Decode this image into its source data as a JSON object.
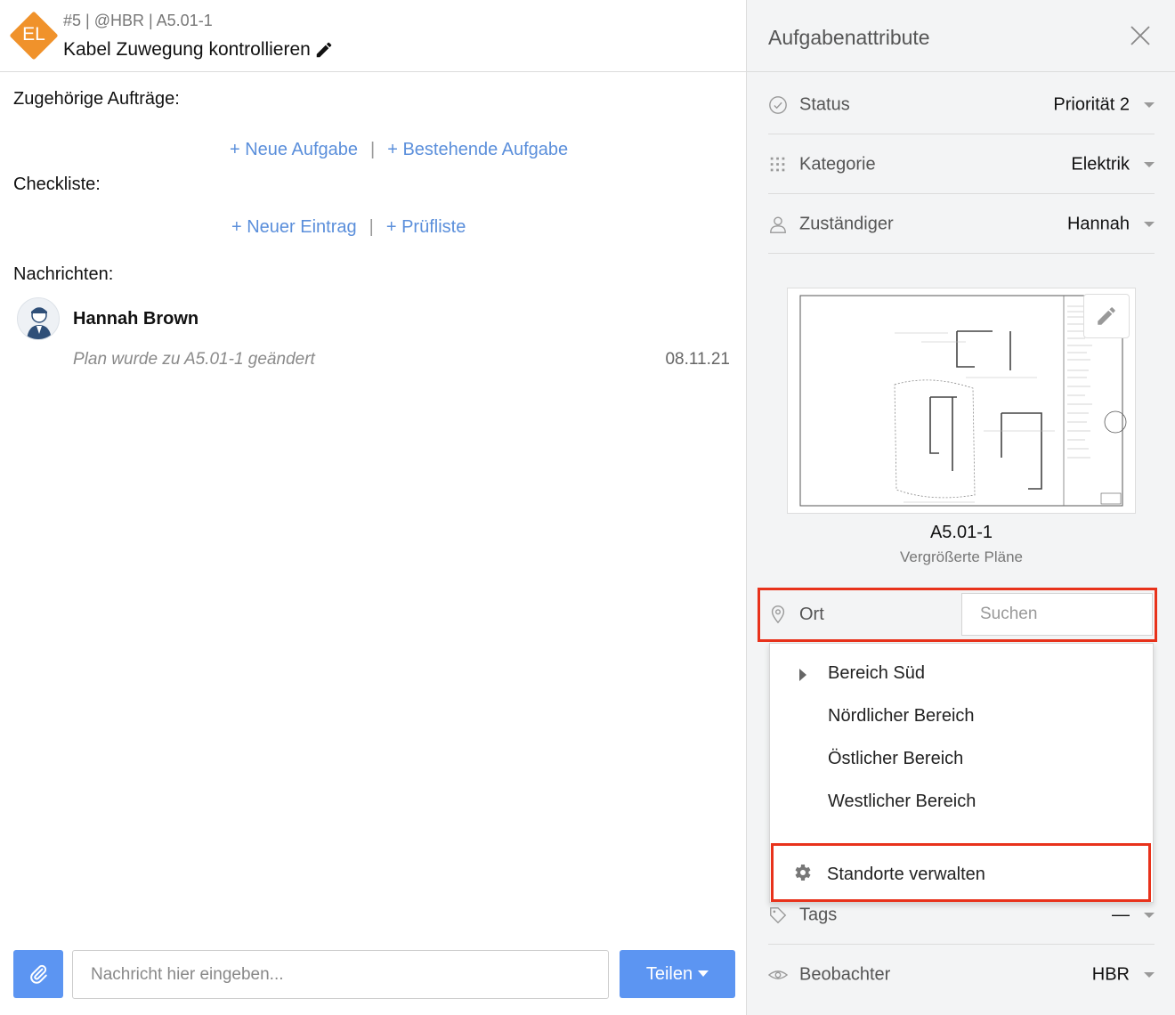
{
  "header": {
    "badge": "EL",
    "meta": "#5 | @HBR | A5.01-1",
    "title": "Kabel Zuwegung kontrollieren"
  },
  "main": {
    "related_label": "Zugehörige Aufträge:",
    "new_task": "+ Neue Aufgabe",
    "existing_task": "+ Bestehende Aufgabe",
    "separator": "|",
    "checklist_label": "Checkliste:",
    "new_entry": "+ Neuer Eintrag",
    "checklist_template": "+ Prüfliste",
    "messages_label": "Nachrichten:",
    "message": {
      "author": "Hannah Brown",
      "text": "Plan wurde zu A5.01-1 geändert",
      "date": "08.11.21"
    }
  },
  "composer": {
    "placeholder": "Nachricht hier eingeben...",
    "share_label": "Teilen"
  },
  "panel": {
    "title": "Aufgabenattribute",
    "attributes": [
      {
        "label": "Status",
        "value": "Priorität 2",
        "icon": "check-circle-icon"
      },
      {
        "label": "Kategorie",
        "value": "Elektrik",
        "icon": "grid-icon"
      },
      {
        "label": "Zuständiger",
        "value": "Hannah",
        "icon": "user-icon"
      }
    ],
    "plan": {
      "name": "A5.01-1",
      "subtitle": "Vergrößerte Pläne"
    },
    "location": {
      "label": "Ort",
      "search_placeholder": "Suchen",
      "options": [
        "Bereich Süd",
        "Nördlicher Bereich",
        "Östlicher Bereich",
        "Westlicher Bereich"
      ],
      "manage_label": "Standorte verwalten"
    },
    "tags": {
      "label": "Tags",
      "value": "—"
    },
    "watchers": {
      "label": "Beobachter",
      "value": "HBR"
    }
  },
  "colors": {
    "accent": "#5c95f2",
    "link": "#5b8fdb",
    "badge": "#f0922b",
    "highlight": "#e8321b"
  }
}
